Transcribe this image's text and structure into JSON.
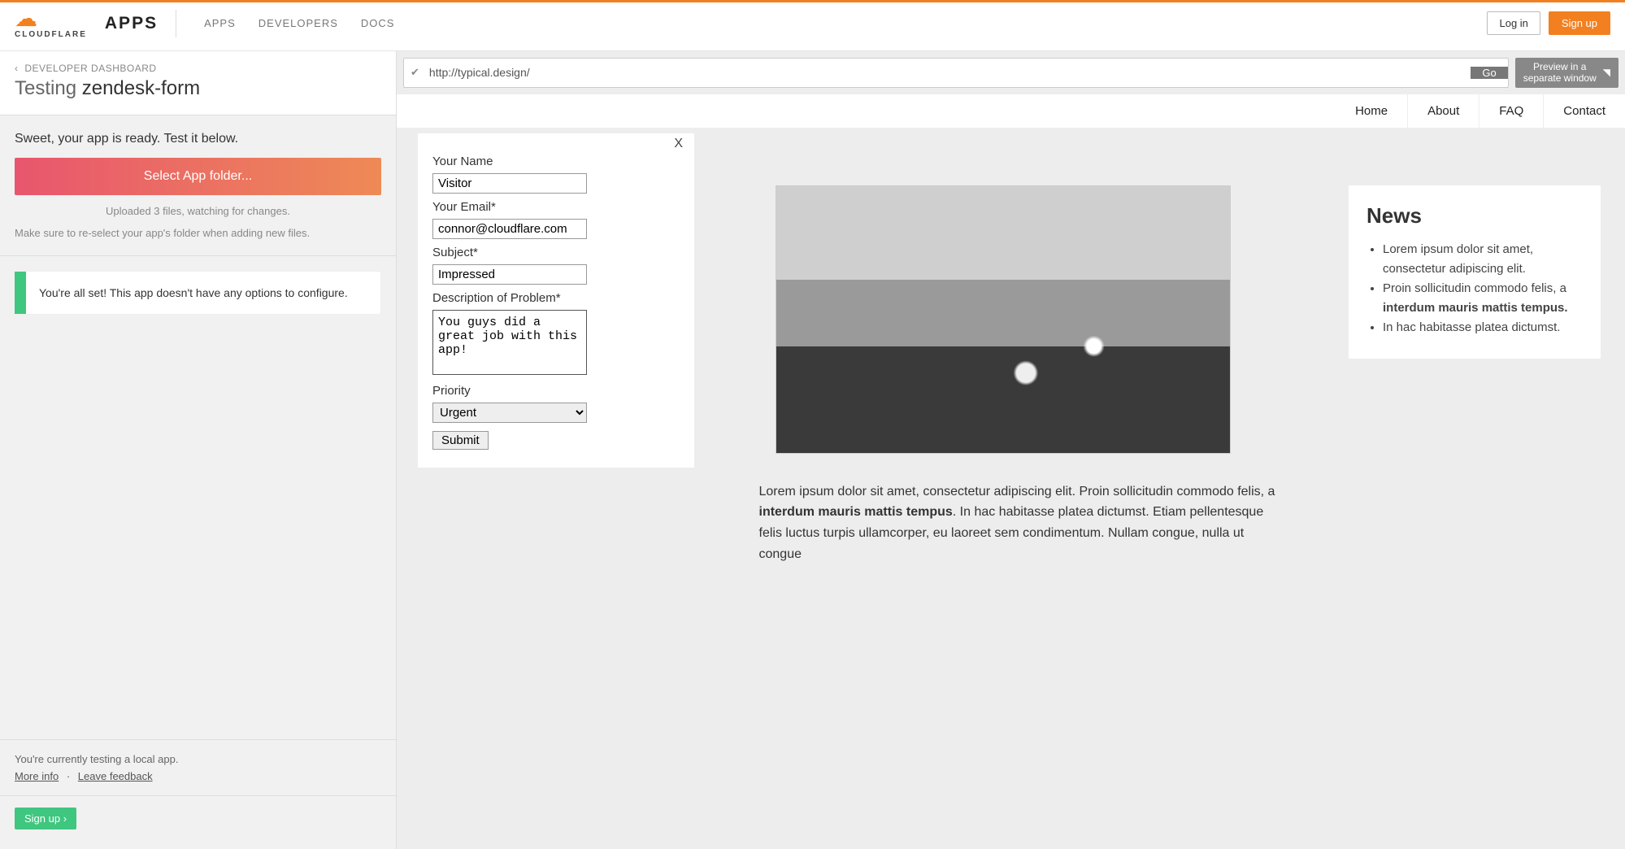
{
  "brand": {
    "name": "CLOUDFLARE",
    "product": "APPS"
  },
  "topnav": {
    "apps": "APPS",
    "developers": "DEVELOPERS",
    "docs": "DOCS"
  },
  "auth": {
    "login": "Log in",
    "signup": "Sign up"
  },
  "crumb": {
    "chevron": "‹",
    "label": "DEVELOPER DASHBOARD"
  },
  "pageTitle": {
    "prefix": "Testing ",
    "name": "zendesk-form"
  },
  "left": {
    "ready": "Sweet, your app is ready. Test it below.",
    "selectFolder": "Select App folder...",
    "uploaded": "Uploaded 3 files, watching for changes.",
    "reselect": "Make sure to re-select your app's folder when adding new files.",
    "infoCard": "You're all set! This app doesn't have any options to configure.",
    "testingLocal": "You're currently testing a local app.",
    "moreInfo": "More info",
    "leaveFeedback": "Leave feedback",
    "signupCta": "Sign up ›"
  },
  "urlbar": {
    "value": "http://typical.design/",
    "go": "Go",
    "previewLine1": "Preview in a",
    "previewLine2": "separate window"
  },
  "siteNav": {
    "home": "Home",
    "about": "About",
    "faq": "FAQ",
    "contact": "Contact"
  },
  "news": {
    "heading": "News",
    "item1a": "Lorem ipsum dolor sit amet, consectetur adipiscing elit.",
    "item2a": "Proin sollicitudin commodo felis, a ",
    "item2b": "interdum mauris mattis tempus.",
    "item3": "In hac habitasse platea dictumst."
  },
  "lorem": {
    "pre": "Lorem ipsum dolor sit amet, consectetur adipiscing elit. Proin sollicitudin commodo felis, a ",
    "bold": "interdum mauris mattis tempus",
    "post": ". In hac habitasse platea dictumst. Etiam pellentesque felis luctus turpis ullamcorper, eu laoreet sem condimentum. Nullam congue, nulla ut congue"
  },
  "form": {
    "close": "X",
    "nameLabel": "Your Name",
    "nameValue": "Visitor",
    "emailLabel": "Your Email*",
    "emailValue": "connor@cloudflare.com",
    "subjectLabel": "Subject*",
    "subjectValue": "Impressed",
    "descLabel": "Description of Problem*",
    "descValue": "You guys did a great job with this app!",
    "priorityLabel": "Priority",
    "priorityValue": "Urgent",
    "submit": "Submit"
  }
}
